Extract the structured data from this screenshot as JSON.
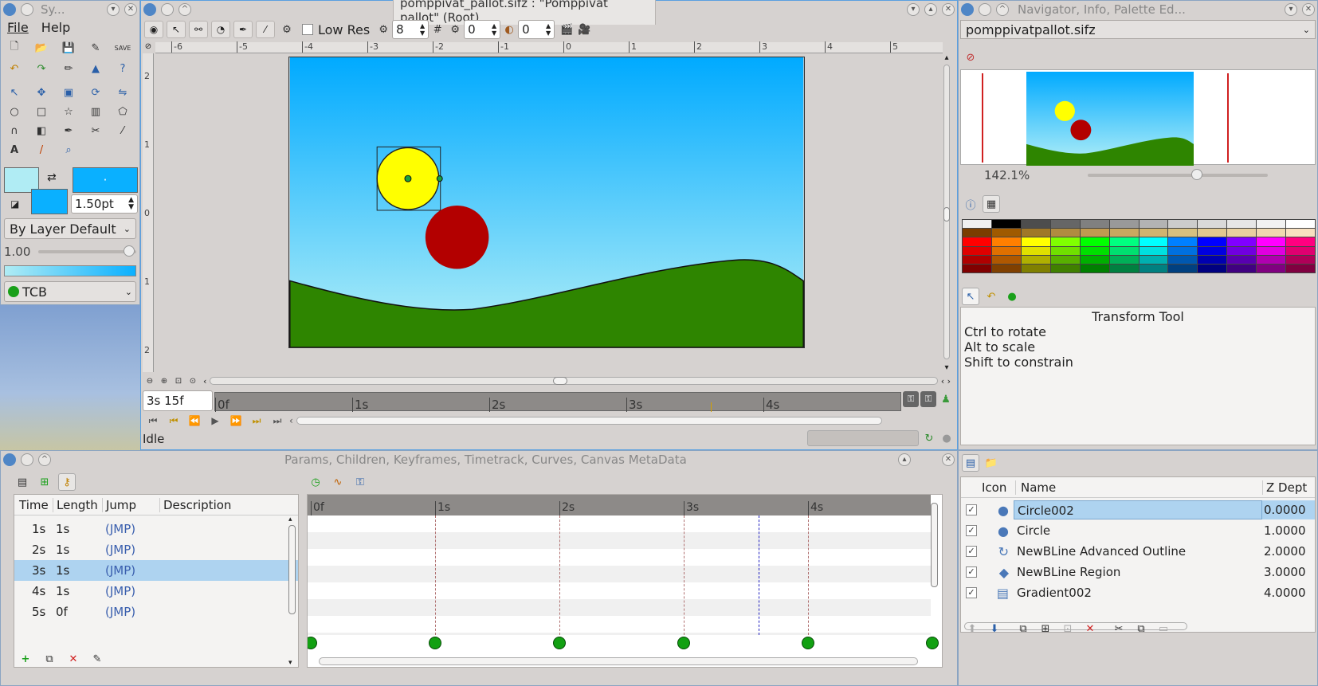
{
  "desktop": {
    "bg_color": "#6b8fb8"
  },
  "toolbox": {
    "title": "Sy...",
    "menu": {
      "file": "File",
      "help": "Help"
    },
    "brush_size": "1.50pt",
    "blend_method": "By Layer Default",
    "opacity": "1.00",
    "interpolation": "TCB",
    "outline_color": "#b0ecf4",
    "fill_color": "#0ab0ff"
  },
  "canvas_window": {
    "title": "pomppivat_pallot.sifz : \"Pomppivat pallot\" (Root)",
    "low_res_label": "Low Res",
    "low_res_value": "8",
    "onion_past": "0",
    "onion_future": "0",
    "ruler_top": [
      "-6",
      "-5",
      "-4",
      "-3",
      "-2",
      "-1",
      "0",
      "1",
      "2",
      "3",
      "4",
      "5"
    ],
    "ruler_left": [
      "2",
      "1",
      "0",
      "1",
      "2"
    ],
    "current_time": "3s 15f",
    "time_ticks": [
      "0f",
      "1s",
      "2s",
      "3s",
      "4s"
    ],
    "status": "Idle",
    "sky_top": "#00aaff",
    "sky_bottom": "#b5f0f7",
    "ground_color": "#2e8500",
    "yellow_ball": "#ffff00",
    "red_ball": "#b30000"
  },
  "navigator": {
    "title": "Navigator, Info, Palette Ed...",
    "file": "pomppivatpallot.sifz",
    "zoom": "142.1%",
    "zoom_level": 0.62
  },
  "palette": {
    "rows": [
      [
        "#f0f0f0",
        "#000000",
        "#4d4d4d",
        "#666666",
        "#808080",
        "#999999",
        "#b3b3b3",
        "#cccccc",
        "#d9d9d9",
        "#e6e6e6",
        "#f2f2f2",
        "#ffffff"
      ],
      [
        "#7a3d00",
        "#a05a00",
        "#a07828",
        "#b08c40",
        "#c09a50",
        "#c8a860",
        "#d0b470",
        "#d8c080",
        "#e0c890",
        "#e8d0a0",
        "#f0d8b0",
        "#f8e0c0"
      ],
      [
        "#ff0000",
        "#ff7f00",
        "#ffff00",
        "#80ff00",
        "#00ff00",
        "#00ff80",
        "#00ffff",
        "#0080ff",
        "#0000ff",
        "#8000ff",
        "#ff00ff",
        "#ff0080"
      ],
      [
        "#e00000",
        "#e07000",
        "#e0e000",
        "#70e000",
        "#00e000",
        "#00e070",
        "#00e0e0",
        "#0070e0",
        "#0000e0",
        "#7000e0",
        "#e000e0",
        "#e00070"
      ],
      [
        "#b00000",
        "#b05800",
        "#b0b000",
        "#58b000",
        "#00b000",
        "#00b058",
        "#00b0b0",
        "#0058b0",
        "#0000b0",
        "#5800b0",
        "#b000b0",
        "#b00058"
      ],
      [
        "#800000",
        "#804000",
        "#808000",
        "#408000",
        "#008000",
        "#008040",
        "#008080",
        "#004080",
        "#000080",
        "#400080",
        "#800080",
        "#800040"
      ]
    ]
  },
  "tool_options": {
    "title": "Transform Tool",
    "lines": [
      "Ctrl to rotate",
      "Alt to scale",
      "Shift to constrain"
    ]
  },
  "params_panel": {
    "title": "Params, Children, Keyframes, Timetrack, Curves, Canvas MetaData",
    "columns": [
      "Time",
      "Length",
      "Jump",
      "Description"
    ],
    "rows": [
      {
        "time": "1s",
        "length": "1s",
        "jump": "(JMP)"
      },
      {
        "time": "2s",
        "length": "1s",
        "jump": "(JMP)"
      },
      {
        "time": "3s",
        "length": "1s",
        "jump": "(JMP)"
      },
      {
        "time": "4s",
        "length": "1s",
        "jump": "(JMP)"
      },
      {
        "time": "5s",
        "length": "0f",
        "jump": "(JMP)"
      }
    ],
    "timetrack_ticks": [
      "0f",
      "1s",
      "2s",
      "3s",
      "4s"
    ]
  },
  "layers_panel": {
    "columns": [
      "Icon",
      "Name",
      "Z Dept"
    ],
    "rows": [
      {
        "name": "Circle002",
        "z": "0.0000",
        "icon": "circle-icon"
      },
      {
        "name": "Circle",
        "z": "1.0000",
        "icon": "circle-icon"
      },
      {
        "name": "NewBLine Advanced Outline",
        "z": "2.0000",
        "icon": "outline-icon"
      },
      {
        "name": "NewBLine Region",
        "z": "3.0000",
        "icon": "region-icon"
      },
      {
        "name": "Gradient002",
        "z": "4.0000",
        "icon": "gradient-icon"
      }
    ]
  }
}
